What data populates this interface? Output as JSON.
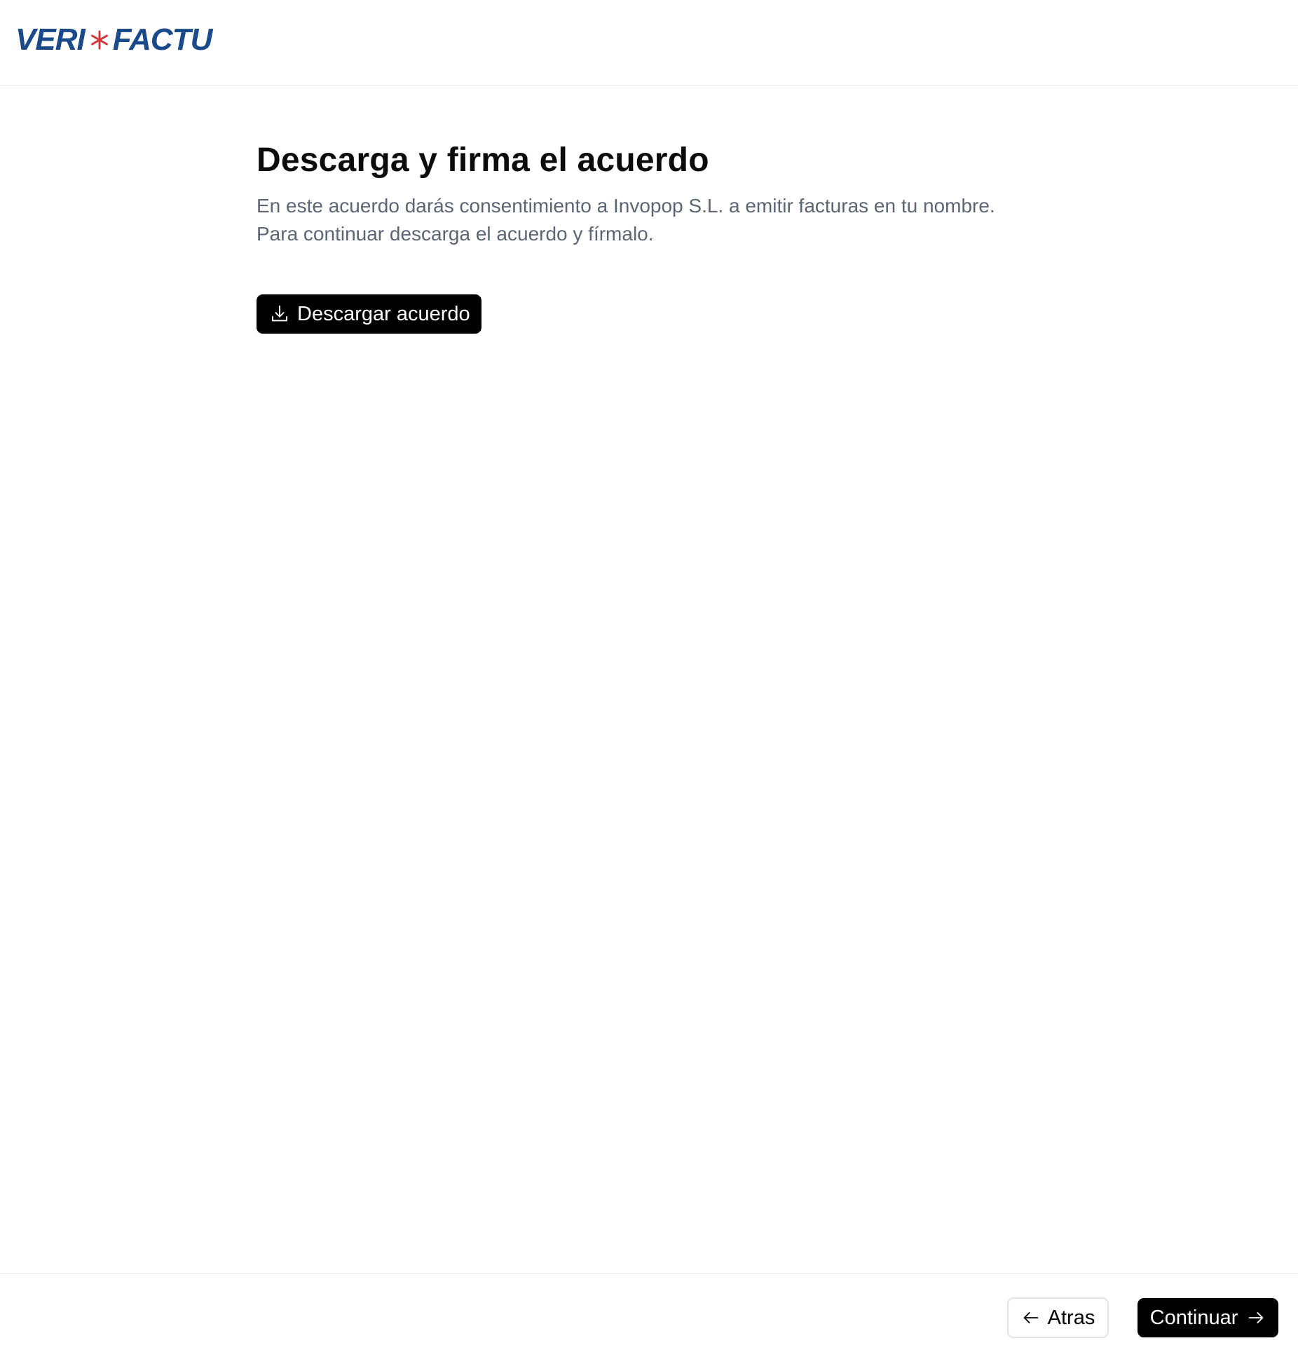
{
  "header": {
    "logo": {
      "left_text": "VERI",
      "right_text": "FACTU",
      "brand_color": "#1b4a8a",
      "star_color": "#d3343a"
    }
  },
  "main": {
    "title": "Descarga y firma el acuerdo",
    "description_lines": [
      "En este acuerdo darás consentimiento a Invopop S.L. a emitir facturas en tu nombre.",
      "Para continuar descarga el acuerdo y fírmalo."
    ],
    "download_button": {
      "label": "Descargar acuerdo",
      "icon": "download-icon"
    }
  },
  "footer": {
    "back_button": {
      "label": "Atras",
      "icon": "arrow-left-icon"
    },
    "continue_button": {
      "label": "Continuar",
      "icon": "arrow-right-icon"
    }
  },
  "colors": {
    "primary_button_bg": "#000000",
    "description_text": "#5e6472",
    "divider": "#e9ebee"
  }
}
